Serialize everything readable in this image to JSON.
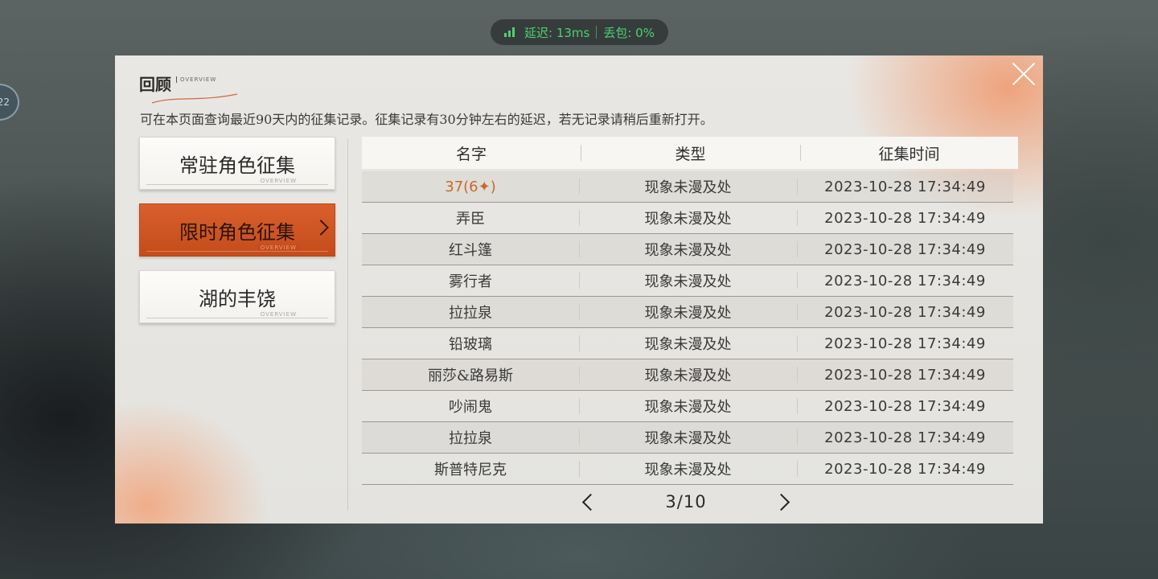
{
  "network": {
    "latency_label": "延迟: 13ms",
    "loss_label": "丢包: 0%",
    "color": "#4fcf73"
  },
  "side_badge": {
    "text": "22"
  },
  "panel": {
    "title": "回顾",
    "title_sub": "OVERVIEW",
    "description": "可在本页面查询最近90天内的征集记录。征集记录有30分钟左右的延迟，若无记录请稍后重新打开。",
    "close_icon": "close-icon"
  },
  "tabs": [
    {
      "label": "常驻角色征集",
      "foot": "OVERVIEW",
      "active": false
    },
    {
      "label": "限时角色征集",
      "foot": "OVERVIEW",
      "active": true
    },
    {
      "label": "湖的丰饶",
      "foot": "OVERVIEW",
      "active": false
    }
  ],
  "table": {
    "headers": {
      "name": "名字",
      "type": "类型",
      "time": "征集时间"
    },
    "rows": [
      {
        "name": "37(6✦)",
        "type": "现象未漫及处",
        "time": "2023-10-28 17:34:49",
        "highlight": true
      },
      {
        "name": "弄臣",
        "type": "现象未漫及处",
        "time": "2023-10-28 17:34:49"
      },
      {
        "name": "红斗篷",
        "type": "现象未漫及处",
        "time": "2023-10-28 17:34:49"
      },
      {
        "name": "雾行者",
        "type": "现象未漫及处",
        "time": "2023-10-28 17:34:49"
      },
      {
        "name": "拉拉泉",
        "type": "现象未漫及处",
        "time": "2023-10-28 17:34:49"
      },
      {
        "name": "铅玻璃",
        "type": "现象未漫及处",
        "time": "2023-10-28 17:34:49"
      },
      {
        "name": "丽莎&路易斯",
        "type": "现象未漫及处",
        "time": "2023-10-28 17:34:49"
      },
      {
        "name": "吵闹鬼",
        "type": "现象未漫及处",
        "time": "2023-10-28 17:34:49"
      },
      {
        "name": "拉拉泉",
        "type": "现象未漫及处",
        "time": "2023-10-28 17:34:49"
      },
      {
        "name": "斯普特尼克",
        "type": "现象未漫及处",
        "time": "2023-10-28 17:34:49"
      }
    ]
  },
  "pager": {
    "label": "3/10",
    "current": 3,
    "total": 10
  },
  "colors": {
    "accent": "#c44c1c",
    "highlight_text": "#c76a2a"
  }
}
